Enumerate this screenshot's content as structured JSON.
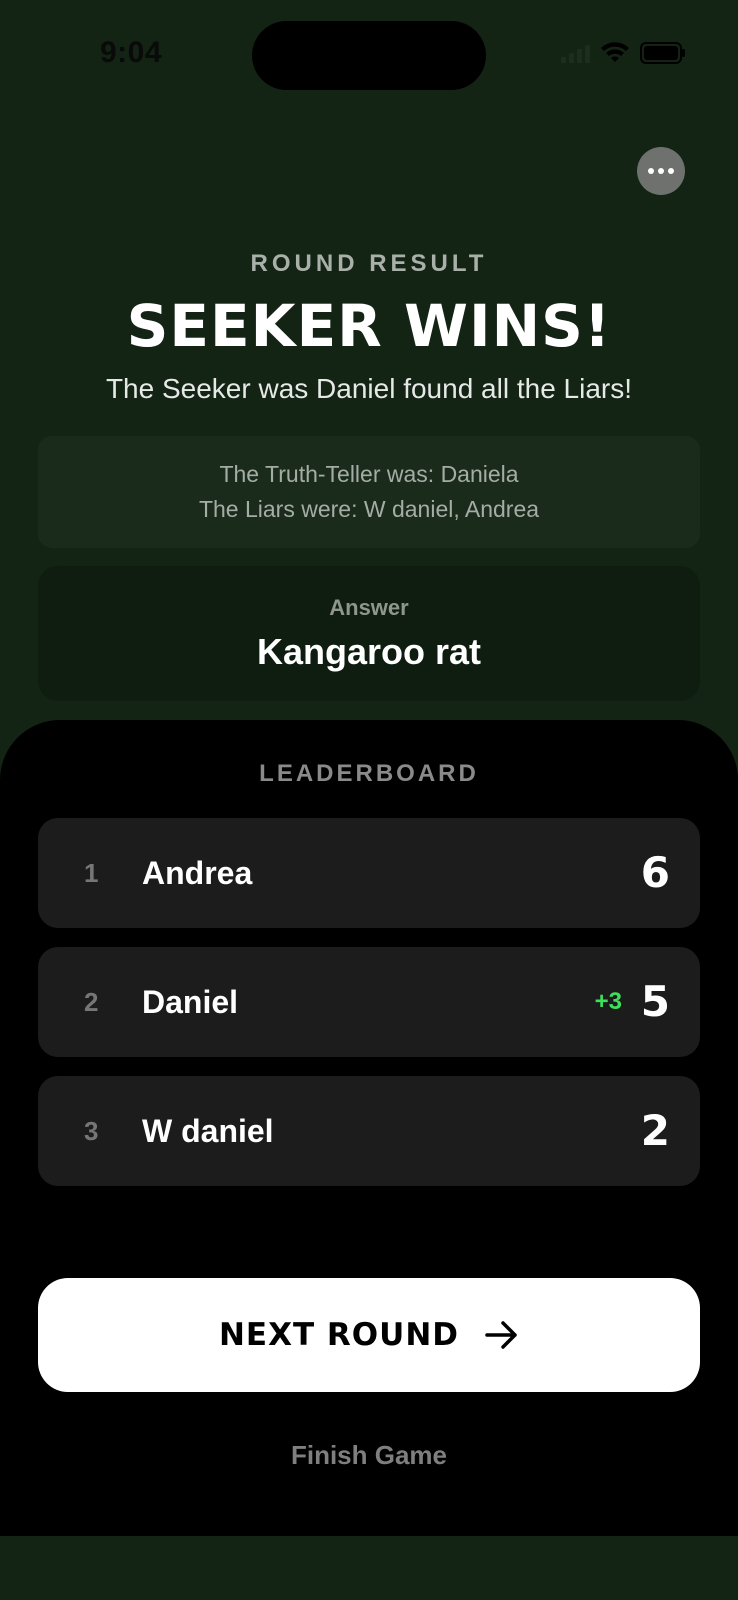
{
  "status_bar": {
    "time": "9:04"
  },
  "header": {
    "more_icon": "ellipsis-icon"
  },
  "result": {
    "label": "ROUND RESULT",
    "headline": "SEEKER WINS!",
    "summary": "The Seeker was Daniel found all the Liars!",
    "truth_teller": "The Truth-Teller was: Daniela",
    "liars": "The Liars were: W daniel, Andrea"
  },
  "answer": {
    "label": "Answer",
    "value": "Kangaroo rat"
  },
  "leaderboard": {
    "title": "LEADERBOARD",
    "players": [
      {
        "rank": "1",
        "name": "Andrea",
        "delta": "",
        "score": "6"
      },
      {
        "rank": "2",
        "name": "Daniel",
        "delta": "+3",
        "score": "5"
      },
      {
        "rank": "3",
        "name": "W daniel",
        "delta": "",
        "score": "2"
      }
    ]
  },
  "actions": {
    "next_round_label": "NEXT ROUND",
    "next_round_icon": "arrow-right-icon",
    "finish_label": "Finish Game"
  },
  "colors": {
    "background": "#132314",
    "sheet": "#000000",
    "row": "#1c1c1c",
    "delta_green": "#3ce05a"
  }
}
